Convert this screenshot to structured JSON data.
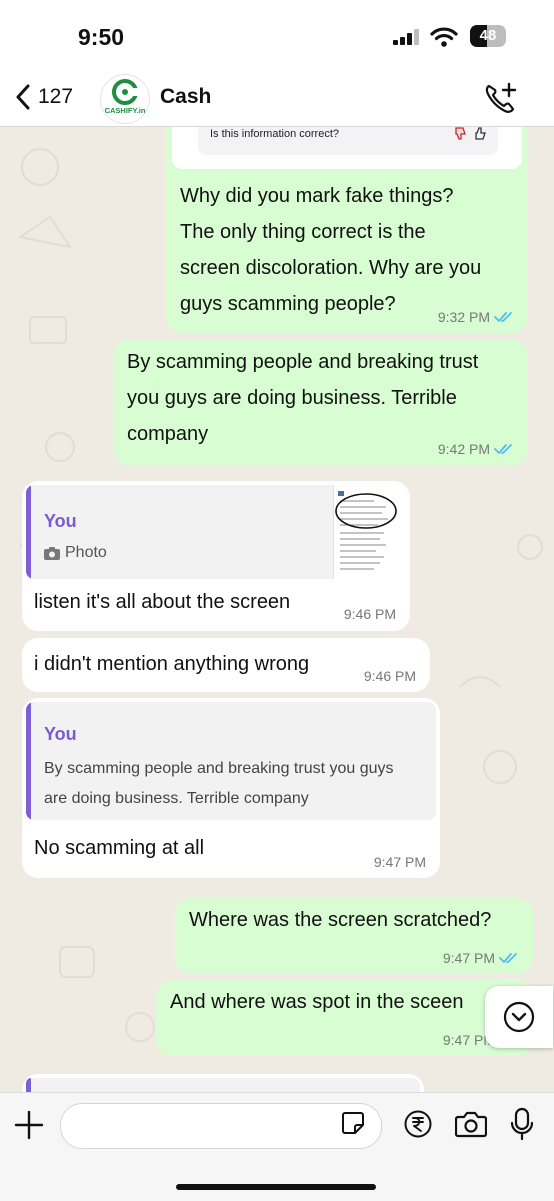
{
  "status_bar": {
    "time": "9:50",
    "battery": "48"
  },
  "header": {
    "back_count": "127",
    "contact_name": "Cash",
    "avatar_logo_text": "CASHIFY.in"
  },
  "messages": [
    {
      "direction": "out",
      "card_text": "Is this information correct?",
      "lines": [
        "Why did you mark fake things?",
        "The only thing correct is the",
        "screen discoloration. Why are you",
        "guys scamming people?"
      ],
      "time": "9:32 PM",
      "status": "read"
    },
    {
      "direction": "out",
      "lines": [
        "By scamming people and breaking trust",
        "you guys are doing business. Terrible",
        "company"
      ],
      "time": "9:42 PM",
      "status": "read"
    },
    {
      "direction": "in",
      "reply_author": "You",
      "reply_snippet": "Photo",
      "lines": [
        "listen it's all about the screen"
      ],
      "time": "9:46 PM"
    },
    {
      "direction": "in",
      "lines": [
        "i didn't mention anything wrong"
      ],
      "time": "9:46 PM"
    },
    {
      "direction": "in",
      "reply_author": "You",
      "reply_lines": [
        "By scamming people and breaking trust you guys",
        "are doing business. Terrible company"
      ],
      "lines": [
        "No scamming at all"
      ],
      "time": "9:47 PM"
    },
    {
      "direction": "out",
      "lines": [
        "Where was the screen scratched?"
      ],
      "time": "9:47 PM",
      "status": "read"
    },
    {
      "direction": "out",
      "lines": [
        "And where was spot in the sceen"
      ],
      "time": "9:47 PM",
      "status": "read"
    }
  ],
  "input": {
    "placeholder": ""
  },
  "colors": {
    "outgoing": "#d9fdd3",
    "incoming": "#ffffff",
    "read_ticks": "#53bdeb",
    "accent": "#7b5ad3"
  },
  "icons": [
    "back-chevron-icon",
    "call-add-icon",
    "camera-icon",
    "thumbs-down-icon",
    "thumbs-up-icon",
    "double-tick-icon",
    "chevron-down-icon",
    "plus-icon",
    "sticker-icon",
    "rupee-icon",
    "mic-icon"
  ]
}
